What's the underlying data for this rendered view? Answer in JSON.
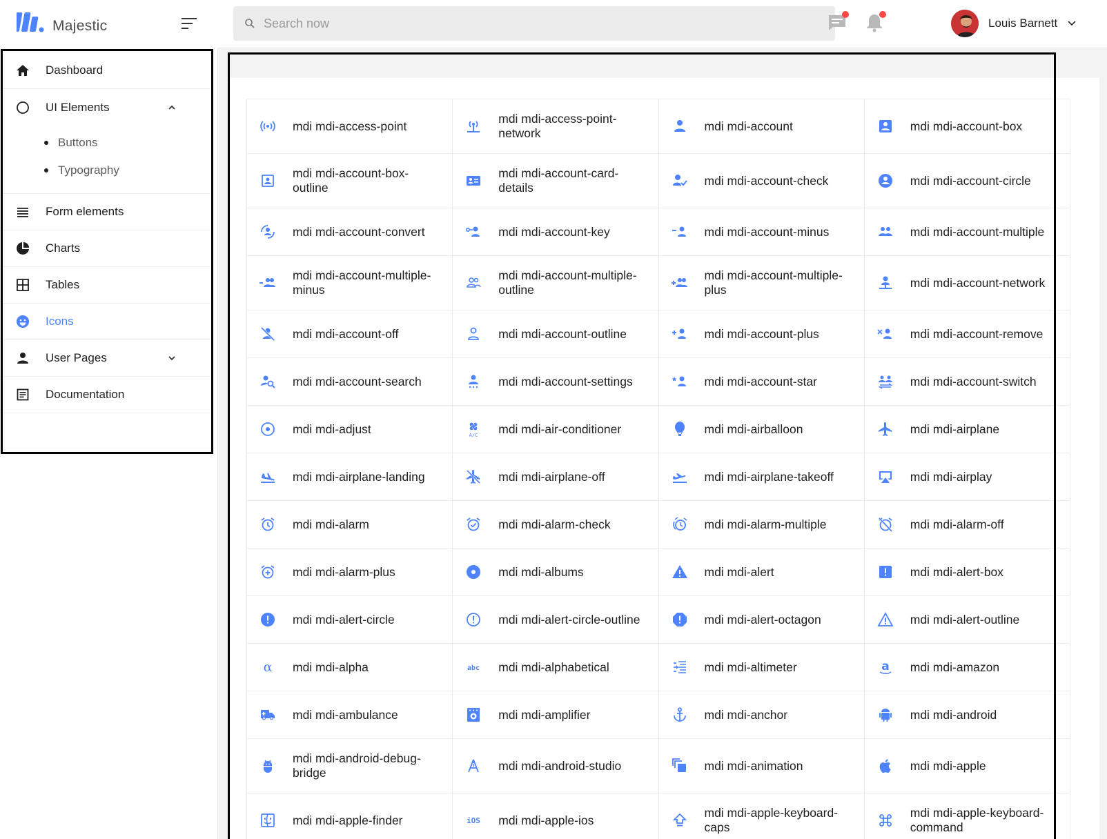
{
  "brand": {
    "name": "Majestic"
  },
  "colors": {
    "accent": "#4d83ff",
    "text": "#1f1f1f",
    "muted": "#5c5c5c",
    "alert_dot": "#ff4747"
  },
  "search": {
    "placeholder": "Search now"
  },
  "topbar": {
    "messages_icon": "message-text-icon",
    "notifications_icon": "bell-icon",
    "user": {
      "name": "Louis Barnett"
    }
  },
  "sidebar": {
    "items": [
      {
        "label": "Dashboard",
        "icon": "home-icon"
      },
      {
        "label": "UI Elements",
        "icon": "circle-outline-icon",
        "expanded": true,
        "children": [
          {
            "label": "Buttons"
          },
          {
            "label": "Typography"
          }
        ]
      },
      {
        "label": "Form elements",
        "icon": "view-headline-icon"
      },
      {
        "label": "Charts",
        "icon": "chart-pie-icon"
      },
      {
        "label": "Tables",
        "icon": "grid-large-icon"
      },
      {
        "label": "Icons",
        "icon": "emoticon-icon",
        "active": true
      },
      {
        "label": "User Pages",
        "icon": "account-icon"
      },
      {
        "label": "Documentation",
        "icon": "file-document-box-icon"
      }
    ]
  },
  "icons": [
    [
      "mdi mdi-access-point",
      "mdi mdi-access-point-network",
      "mdi mdi-account",
      "mdi mdi-account-box"
    ],
    [
      "mdi mdi-account-box-outline",
      "mdi mdi-account-card-details",
      "mdi mdi-account-check",
      "mdi mdi-account-circle"
    ],
    [
      "mdi mdi-account-convert",
      "mdi mdi-account-key",
      "mdi mdi-account-minus",
      "mdi mdi-account-multiple"
    ],
    [
      "mdi mdi-account-multiple-minus",
      "mdi mdi-account-multiple-outline",
      "mdi mdi-account-multiple-plus",
      "mdi mdi-account-network"
    ],
    [
      "mdi mdi-account-off",
      "mdi mdi-account-outline",
      "mdi mdi-account-plus",
      "mdi mdi-account-remove"
    ],
    [
      "mdi mdi-account-search",
      "mdi mdi-account-settings",
      "mdi mdi-account-star",
      "mdi mdi-account-switch"
    ],
    [
      "mdi mdi-adjust",
      "mdi mdi-air-conditioner",
      "mdi mdi-airballoon",
      "mdi mdi-airplane"
    ],
    [
      "mdi mdi-airplane-landing",
      "mdi mdi-airplane-off",
      "mdi mdi-airplane-takeoff",
      "mdi mdi-airplay"
    ],
    [
      "mdi mdi-alarm",
      "mdi mdi-alarm-check",
      "mdi mdi-alarm-multiple",
      "mdi mdi-alarm-off"
    ],
    [
      "mdi mdi-alarm-plus",
      "mdi mdi-albums",
      "mdi mdi-alert",
      "mdi mdi-alert-box"
    ],
    [
      "mdi mdi-alert-circle",
      "mdi mdi-alert-circle-outline",
      "mdi mdi-alert-octagon",
      "mdi mdi-alert-outline"
    ],
    [
      "mdi mdi-alpha",
      "mdi mdi-alphabetical",
      "mdi mdi-altimeter",
      "mdi mdi-amazon"
    ],
    [
      "mdi mdi-ambulance",
      "mdi mdi-amplifier",
      "mdi mdi-anchor",
      "mdi mdi-android"
    ],
    [
      "mdi mdi-android-debug-bridge",
      "mdi mdi-android-studio",
      "mdi mdi-animation",
      "mdi mdi-apple"
    ],
    [
      "mdi mdi-apple-finder",
      "mdi mdi-apple-ios",
      "mdi mdi-apple-keyboard-caps",
      "mdi mdi-apple-keyboard-command"
    ]
  ]
}
